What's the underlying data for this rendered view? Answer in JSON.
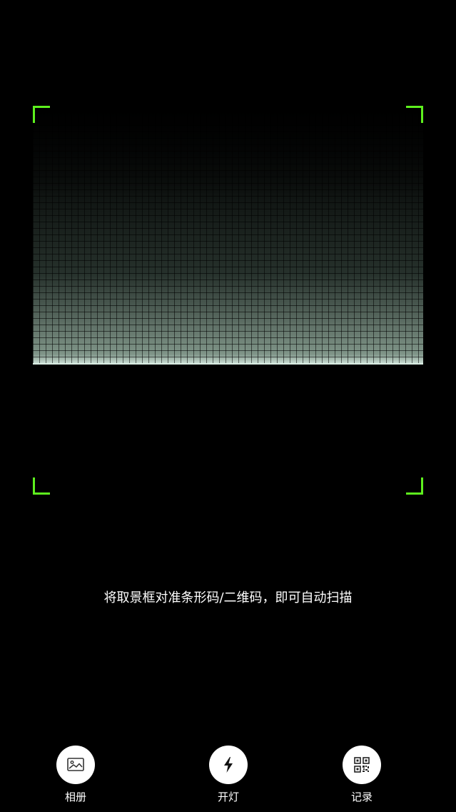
{
  "scanner": {
    "frame_color": "#5ef01e"
  },
  "hint": {
    "text": "将取景框对准条形码/二维码，即可自动扫描"
  },
  "toolbar": {
    "album": {
      "label": "相册",
      "icon": "image-icon"
    },
    "flash": {
      "label": "开灯",
      "icon": "flash-icon"
    },
    "history": {
      "label": "记录",
      "icon": "qr-code-icon"
    }
  }
}
